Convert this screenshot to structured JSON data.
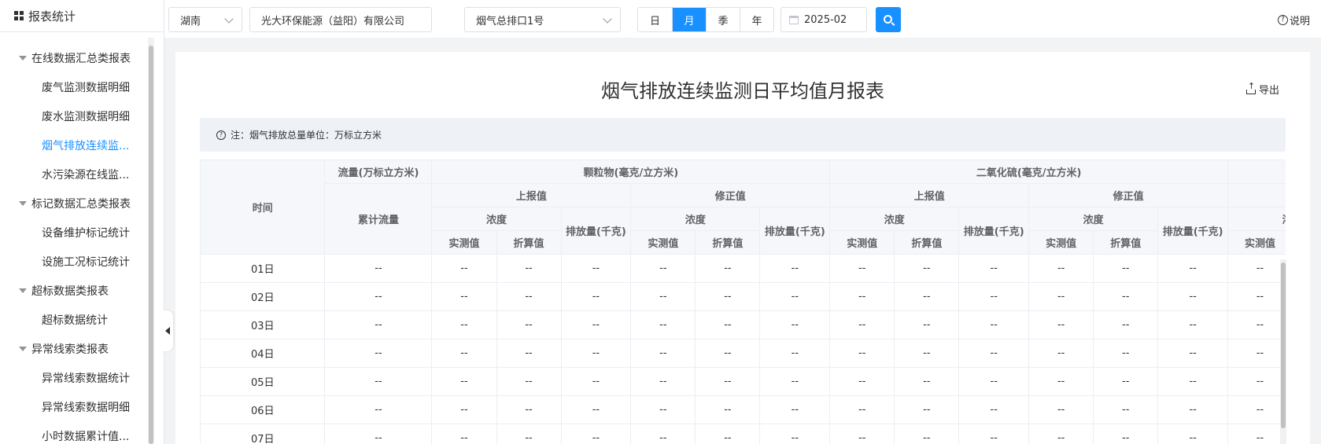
{
  "sidebar": {
    "title": "报表统计",
    "menu": [
      {
        "type": "group",
        "label": "在线数据汇总类报表"
      },
      {
        "type": "item",
        "label": "废气监测数据明细"
      },
      {
        "type": "item",
        "label": "废水监测数据明细"
      },
      {
        "type": "item",
        "label": "烟气排放连续监...",
        "active": true
      },
      {
        "type": "item",
        "label": "水污染源在线监..."
      },
      {
        "type": "group",
        "label": "标记数据汇总类报表"
      },
      {
        "type": "item",
        "label": "设备维护标记统计"
      },
      {
        "type": "item",
        "label": "设施工况标记统计"
      },
      {
        "type": "group",
        "label": "超标数据类报表"
      },
      {
        "type": "item",
        "label": "超标数据统计"
      },
      {
        "type": "group",
        "label": "异常线索类报表"
      },
      {
        "type": "item",
        "label": "异常线索数据统计"
      },
      {
        "type": "item",
        "label": "异常线索数据明细"
      },
      {
        "type": "item",
        "label": "小时数据累计值..."
      }
    ]
  },
  "filters": {
    "region": "湖南",
    "company": "光大环保能源（益阳）有限公司",
    "outlet": "烟气总排口1号",
    "period_options": [
      "日",
      "月",
      "季",
      "年"
    ],
    "period_selected": "月",
    "date": "2025-02",
    "help_label": "说明"
  },
  "report": {
    "title": "烟气排放连续监测日平均值月报表",
    "export_label": "导出",
    "note": "注：烟气排放总量单位：万标立方米"
  },
  "table": {
    "time_header": "时间",
    "flow_header": "流量(万标立方米)",
    "cumulative_flow": "累计流量",
    "pollutants": [
      "颗粒物(毫克/立方米)",
      "二氧化硫(毫克/立方米)"
    ],
    "reported": "上报值",
    "corrected": "修正值",
    "concentration": "浓度",
    "emission": "排放量(千克)",
    "measured": "实测值",
    "converted": "折算值",
    "placeholder": "--",
    "rows": [
      "01日",
      "02日",
      "03日",
      "04日",
      "05日",
      "06日",
      "07日"
    ]
  },
  "colors": {
    "accent": "#1890ff",
    "header_bg": "#f5f7fa",
    "note_bg": "#eef1f6"
  }
}
